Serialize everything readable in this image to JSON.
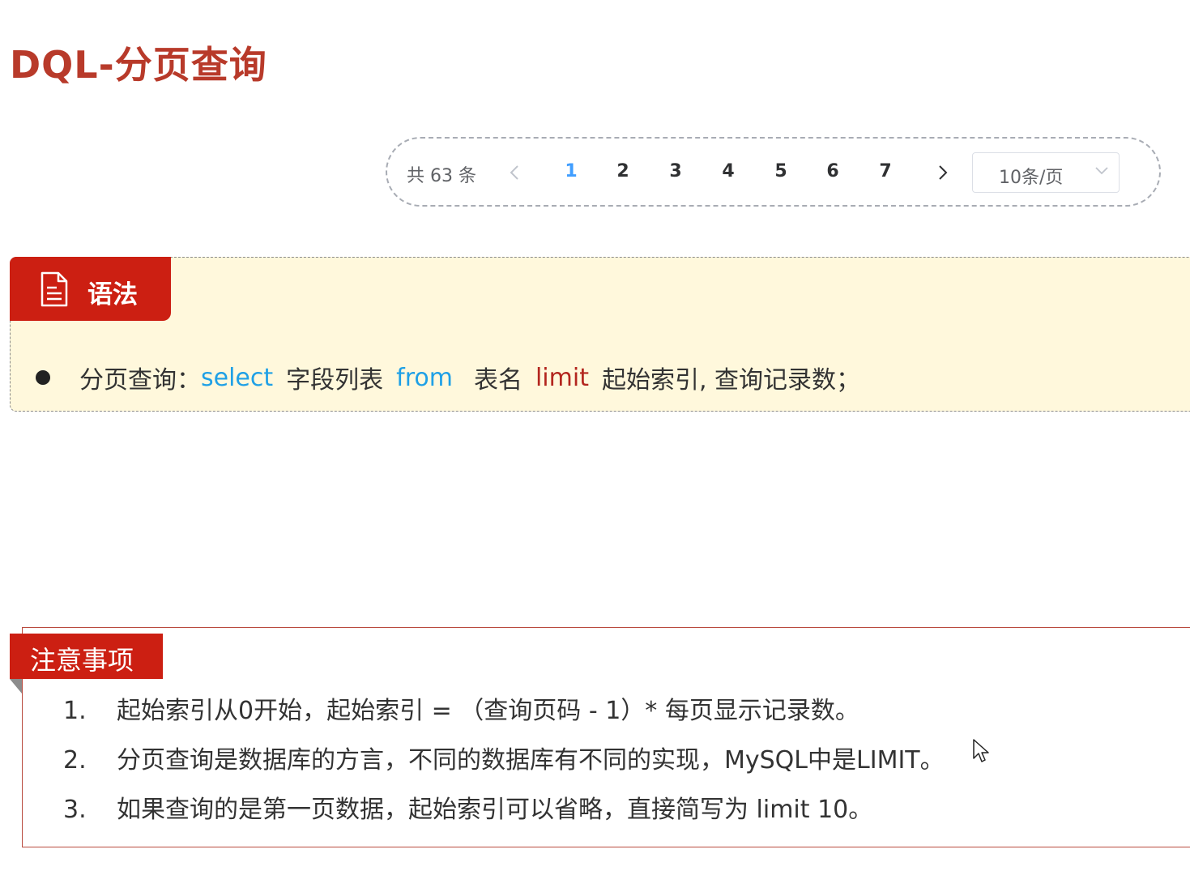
{
  "page": {
    "title": "DQL-分页查询"
  },
  "pagination": {
    "total_label": "共 63 条",
    "pages": [
      "1",
      "2",
      "3",
      "4",
      "5",
      "6",
      "7"
    ],
    "active_page": "1",
    "page_size": "10条/页"
  },
  "syntax": {
    "tab_label": "语法",
    "line": {
      "prefix": "分页查询：",
      "kw_select": "select",
      "fields": "字段列表",
      "kw_from": "from",
      "table": "表名",
      "kw_limit": "limit",
      "rest": "起始索引, 查询记录数；"
    }
  },
  "notes": {
    "tab_label": "注意事项",
    "items": [
      {
        "num": "1.",
        "text": "起始索引从0开始，起始索引 = （查询页码 - 1）* 每页显示记录数。"
      },
      {
        "num": "2.",
        "text": "分页查询是数据库的方言，不同的数据库有不同的实现，MySQL中是LIMIT。"
      },
      {
        "num": "3.",
        "text": "如果查询的是第一页数据，起始索引可以省略，直接简写为 limit 10。"
      }
    ]
  },
  "colors": {
    "title": "#b83a2a",
    "tab_red": "#cc1f12",
    "syntax_bg": "#fff8dc",
    "keyword_blue": "#1fa0e6",
    "keyword_red": "#b3261e",
    "active_page": "#409eff"
  },
  "icons": {
    "syntax_tab": "document-icon",
    "prev": "chevron-left-icon",
    "next": "chevron-right-icon",
    "page_size": "chevron-down-icon",
    "cursor": "mouse-cursor-icon"
  }
}
